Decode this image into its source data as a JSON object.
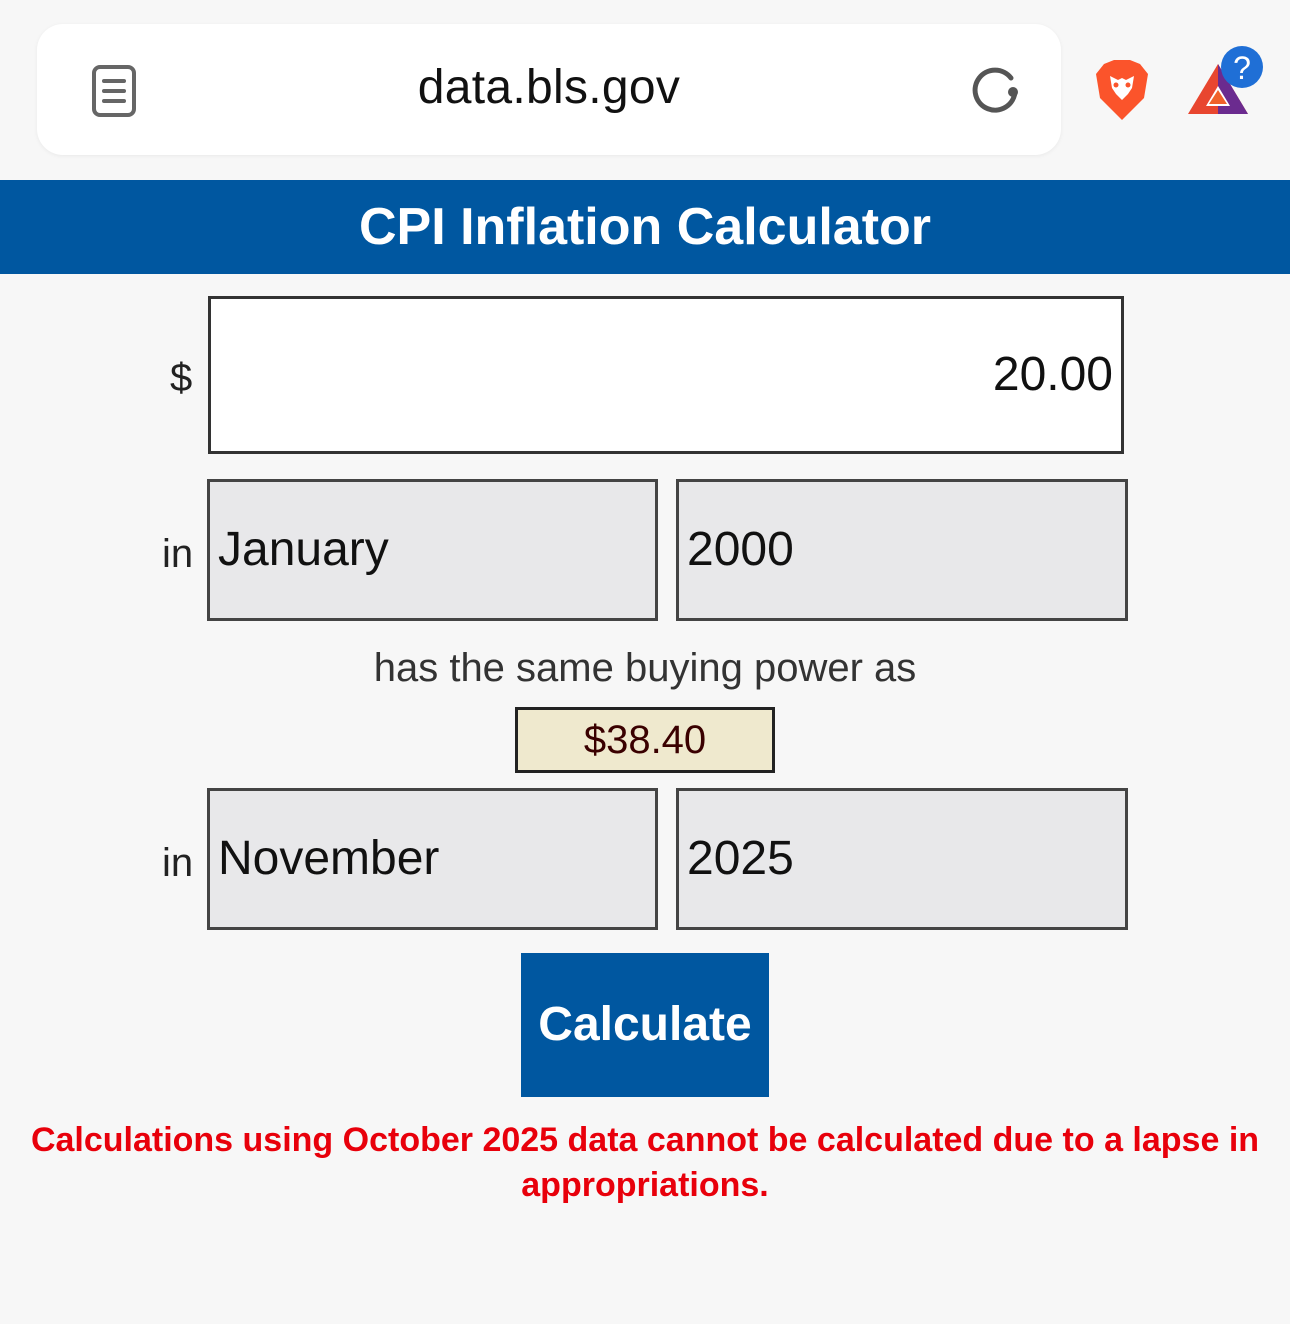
{
  "browser": {
    "url": "data.bls.gov",
    "icons": [
      "reader-icon",
      "reload-icon",
      "brave-lion-icon",
      "bat-rewards-icon"
    ],
    "badge": "?"
  },
  "page": {
    "title": "CPI Inflation Calculator",
    "currency_symbol": "$",
    "amount_value": "20.00",
    "in_label_1": "in",
    "from_month": "January",
    "from_year": "2000",
    "same_power_text": "has the same buying power as",
    "result_value": "$38.40",
    "in_label_2": "in",
    "to_month": "November",
    "to_year": "2025",
    "calculate_label": "Calculate",
    "warning": "Calculations using October 2025 data cannot be calculated due to a lapse in appropriations."
  },
  "colors": {
    "banner": "#0057a0",
    "warning": "#e8000b",
    "result_bg": "#efe9ce"
  }
}
